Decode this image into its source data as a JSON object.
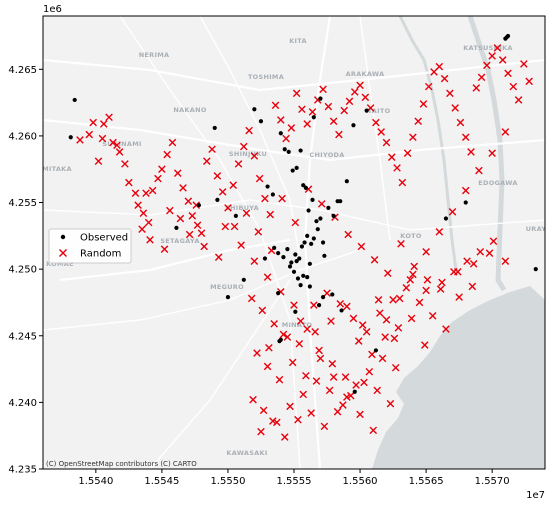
{
  "chart_data": {
    "type": "scatter",
    "x_offset_label": "1e7",
    "y_offset_label": "1e6",
    "xlim": [
      15536000,
      15574000
    ],
    "ylim": [
      4235000,
      4269000
    ],
    "x_ticks": [
      15540000,
      15545000,
      15550000,
      15555000,
      15560000,
      15565000,
      15570000
    ],
    "x_tick_labels": [
      "1.5540",
      "1.5545",
      "1.5550",
      "1.5555",
      "1.5560",
      "1.5565",
      "1.5570"
    ],
    "y_ticks": [
      4235000,
      4240000,
      4245000,
      4250000,
      4255000,
      4260000,
      4265000
    ],
    "y_tick_labels": [
      "4.235",
      "4.240",
      "4.245",
      "4.250",
      "4.255",
      "4.260",
      "4.265"
    ],
    "legend_position": "center-left",
    "attribution": "(C) OpenStreetMap contributors (C) CARTO",
    "basemap_labels": [
      "KITA",
      "NERIMA",
      "ARAKAWA",
      "KATSUSHIKA",
      "TOSHIMA",
      "NAKANO",
      "TAITO",
      "SUGINAMI",
      "SHINJUKU",
      "CHIYODA",
      "MITAKA",
      "EDOGAWA",
      "SHIBUYA",
      "KOTO",
      "URAY",
      "SETAGAYA",
      "KOMAE",
      "MEGURO",
      "MINATO",
      "KAWASAKI"
    ],
    "series": [
      {
        "name": "Observed",
        "marker": "dot",
        "color": "#000000",
        "x": [
          15538100,
          15538400,
          15546100,
          15547800,
          15549000,
          15549200,
          15550600,
          15552000,
          15552500,
          15553000,
          15553400,
          15553800,
          15554200,
          15554500,
          15554800,
          15555100,
          15555400,
          15555600,
          15555800,
          15556000,
          15556300,
          15556500,
          15556800,
          15557000,
          15557300,
          15557600,
          15558000,
          15558500,
          15559000,
          15554000,
          15554300,
          15554600,
          15554900,
          15555200,
          15555500,
          15555700,
          15555900,
          15556100,
          15556400,
          15556700,
          15555000,
          15555300,
          15555700,
          15556000,
          15554700,
          15555200,
          15556200,
          15553500,
          15557200,
          15552800,
          15558300,
          15559500,
          15556500,
          15557000,
          15560500,
          15568000,
          15571000,
          15571100,
          15571200,
          15573300,
          15566500,
          15550000,
          15553800,
          15561200,
          15555500,
          15556200,
          15557900,
          15557200,
          15558600,
          15559600,
          15554000,
          15553900,
          15551200,
          15555100,
          15556900
        ],
        "y": [
          4259900,
          4262700,
          4253100,
          4254800,
          4260600,
          4255200,
          4254000,
          4262000,
          4261100,
          4256200,
          4255600,
          4251200,
          4250900,
          4251500,
          4250500,
          4251100,
          4250800,
          4251700,
          4252000,
          4252500,
          4251900,
          4252300,
          4253000,
          4253800,
          4251000,
          4254600,
          4254000,
          4255100,
          4256600,
          4260200,
          4259000,
          4258800,
          4257400,
          4257600,
          4258900,
          4256300,
          4256100,
          4254400,
          4255200,
          4253600,
          4249800,
          4249300,
          4249500,
          4249400,
          4250200,
          4250600,
          4250400,
          4251600,
          4252000,
          4250800,
          4255100,
          4260800,
          4261400,
          4262800,
          4261900,
          4255000,
          4267300,
          4267400,
          4267500,
          4250000,
          4253800,
          4247900,
          4248200,
          4243900,
          4248800,
          4248700,
          4248100,
          4247900,
          4246900,
          4240800,
          4244700,
          4244600,
          4249200,
          4246800,
          4247300
        ]
      },
      {
        "name": "Random",
        "marker": "x",
        "color": "#e8000b",
        "x": [
          15539500,
          15539800,
          15540500,
          15540600,
          15541000,
          15541300,
          15541800,
          15542200,
          15542500,
          15543000,
          15543200,
          15543600,
          15544000,
          15544300,
          15544700,
          15545000,
          15545400,
          15545800,
          15546200,
          15546600,
          15547000,
          15547300,
          15547700,
          15548000,
          15548400,
          15548800,
          15549200,
          15549600,
          15550000,
          15550400,
          15550800,
          15551200,
          15551600,
          15552000,
          15552400,
          15552800,
          15553200,
          15553600,
          15554000,
          15554400,
          15554800,
          15555200,
          15555600,
          15556000,
          15556400,
          15556800,
          15557200,
          15557600,
          15558000,
          15558400,
          15558800,
          15559200,
          15559600,
          15560000,
          15560400,
          15560800,
          15561200,
          15561600,
          15562000,
          15562400,
          15562800,
          15563200,
          15563600,
          15564000,
          15564400,
          15564800,
          15565200,
          15565600,
          15566000,
          15566400,
          15566800,
          15567200,
          15567600,
          15568000,
          15568400,
          15568800,
          15569200,
          15569600,
          15570000,
          15570400,
          15570800,
          15571200,
          15571600,
          15572000,
          15572400,
          15572800,
          15543500,
          15544100,
          15545200,
          15546400,
          15547100,
          15548200,
          15549300,
          15550500,
          15551400,
          15552300,
          15553300,
          15554100,
          15555100,
          15556100,
          15557100,
          15558100,
          15559100,
          15560100,
          15561100,
          15562100,
          15563100,
          15564100,
          15565100,
          15566100,
          15567100,
          15568100,
          15569100,
          15570100,
          15551800,
          15552600,
          15553500,
          15554500,
          15555500,
          15556500,
          15557500,
          15558500,
          15559500,
          15560500,
          15561500,
          15562500,
          15563500,
          15564500,
          15565500,
          15566500,
          15567500,
          15568500,
          15552200,
          15553000,
          15553900,
          15554900,
          15555900,
          15556900,
          15557900,
          15558900,
          15559900,
          15560900,
          15561900,
          15562900,
          15563900,
          15564900,
          15551900,
          15552700,
          15553700,
          15554700,
          15555700,
          15556700,
          15557700,
          15558700,
          15559700,
          15560700,
          15561700,
          15562700,
          15552500,
          15553400,
          15554300,
          15555300,
          15556300,
          15557300,
          15558300,
          15559300,
          15560300,
          15561300,
          15562300,
          15553100,
          15554200,
          15555400,
          15556600,
          15557800,
          15559000,
          15560200,
          15561400,
          15562600,
          15563800,
          15565000,
          15566200,
          15567400,
          15568600,
          15569800,
          15571000,
          15538800,
          15540200,
          15541600,
          15543800,
          15545600,
          15547600,
          15549800,
          15551000,
          15552000,
          15553000,
          15554000,
          15555000,
          15556000,
          15557000,
          15558000,
          15559000,
          15560000,
          15561000,
          15562000,
          15563000,
          15564000,
          15565000,
          15566000,
          15567000,
          15568000,
          15569000,
          15570000,
          15571000
        ],
        "y": [
          4260100,
          4261000,
          4259800,
          4260900,
          4261400,
          4259500,
          4258800,
          4257900,
          4256500,
          4255700,
          4254800,
          4254200,
          4253500,
          4255900,
          4256800,
          4257500,
          4258600,
          4259500,
          4257200,
          4256100,
          4255100,
          4254000,
          4253300,
          4252700,
          4258100,
          4259000,
          4257000,
          4255800,
          4254600,
          4256300,
          4257900,
          4259200,
          4260400,
          4258500,
          4256800,
          4255300,
          4254100,
          4262300,
          4261200,
          4259800,
          4260600,
          4263200,
          4262000,
          4260900,
          4261800,
          4262700,
          4263500,
          4262200,
          4261100,
          4260100,
          4261900,
          4262600,
          4263300,
          4263800,
          4262900,
          4262100,
          4261000,
          4260300,
          4259500,
          4258400,
          4257600,
          4256500,
          4258700,
          4259900,
          4261100,
          4262400,
          4263700,
          4264800,
          4265200,
          4264300,
          4263200,
          4262100,
          4261000,
          4259900,
          4258800,
          4263600,
          4264400,
          4265300,
          4266000,
          4266600,
          4265700,
          4264700,
          4263700,
          4262700,
          4265400,
          4264100,
          4253000,
          4252200,
          4251500,
          4253800,
          4252600,
          4251700,
          4250900,
          4253200,
          4254200,
          4252800,
          4251400,
          4255300,
          4253500,
          4256000,
          4254900,
          4253900,
          4252600,
          4251700,
          4250700,
          4249700,
          4251900,
          4250200,
          4249200,
          4248500,
          4249800,
          4250600,
          4251300,
          4252100,
          4247800,
          4246900,
          4245900,
          4244900,
          4246100,
          4247300,
          4248200,
          4247400,
          4246300,
          4245300,
          4246700,
          4247700,
          4248600,
          4247500,
          4246500,
          4245500,
          4247900,
          4248700,
          4243700,
          4242700,
          4241700,
          4243000,
          4242000,
          4243900,
          4242900,
          4241900,
          4244600,
          4243600,
          4244900,
          4245600,
          4246300,
          4244300,
          4240200,
          4239400,
          4238500,
          4239700,
          4240600,
          4241600,
          4240900,
          4239800,
          4241300,
          4242300,
          4243300,
          4242600,
          4237800,
          4238600,
          4237400,
          4238700,
          4239200,
          4238200,
          4239300,
          4240500,
          4241500,
          4240900,
          4239900,
          4244100,
          4245100,
          4244400,
          4245300,
          4246100,
          4247200,
          4245800,
          4247700,
          4244800,
          4249200,
          4248400,
          4249000,
          4249800,
          4250400,
          4251200,
          4250600,
          4259700,
          4258100,
          4259300,
          4255700,
          4254400,
          4254800,
          4253200,
          4251800,
          4250600,
          4249400,
          4248300,
          4247300,
          4245500,
          4243300,
          4241900,
          4240400,
          4239100,
          4237900,
          4246200,
          4247800,
          4249600,
          4251300,
          4252800,
          4254300,
          4255900,
          4257400,
          4258700,
          4260300
        ]
      }
    ]
  }
}
